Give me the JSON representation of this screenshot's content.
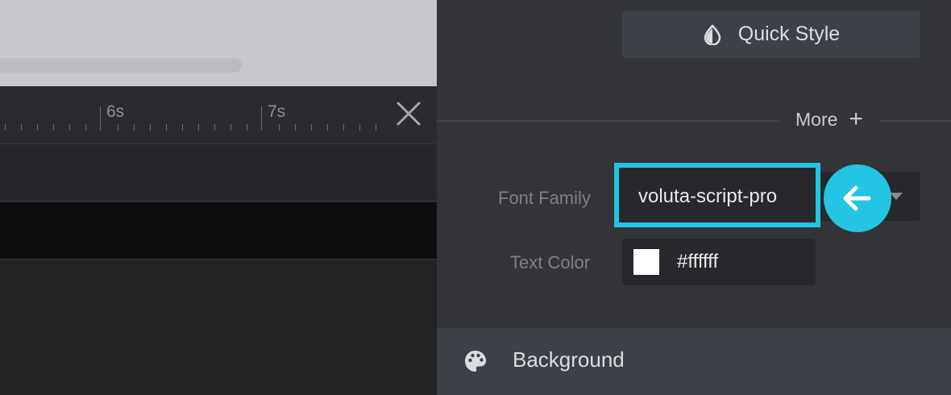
{
  "timeline": {
    "tick_labels": [
      "6s",
      "7s"
    ]
  },
  "panel": {
    "quick_style_label": "Quick Style",
    "more_label": "More",
    "font_family_label": "Font Family",
    "font_family_value": "voluta-script-pro",
    "text_color_label": "Text Color",
    "text_color_value": "#ffffff",
    "background_label": "Background"
  },
  "colors": {
    "highlight": "#23c5e2",
    "swatch": "#ffffff"
  },
  "icons": [
    "close-icon",
    "droplet-icon",
    "plus-icon",
    "chevron-down-icon",
    "arrow-left-icon",
    "palette-icon"
  ]
}
